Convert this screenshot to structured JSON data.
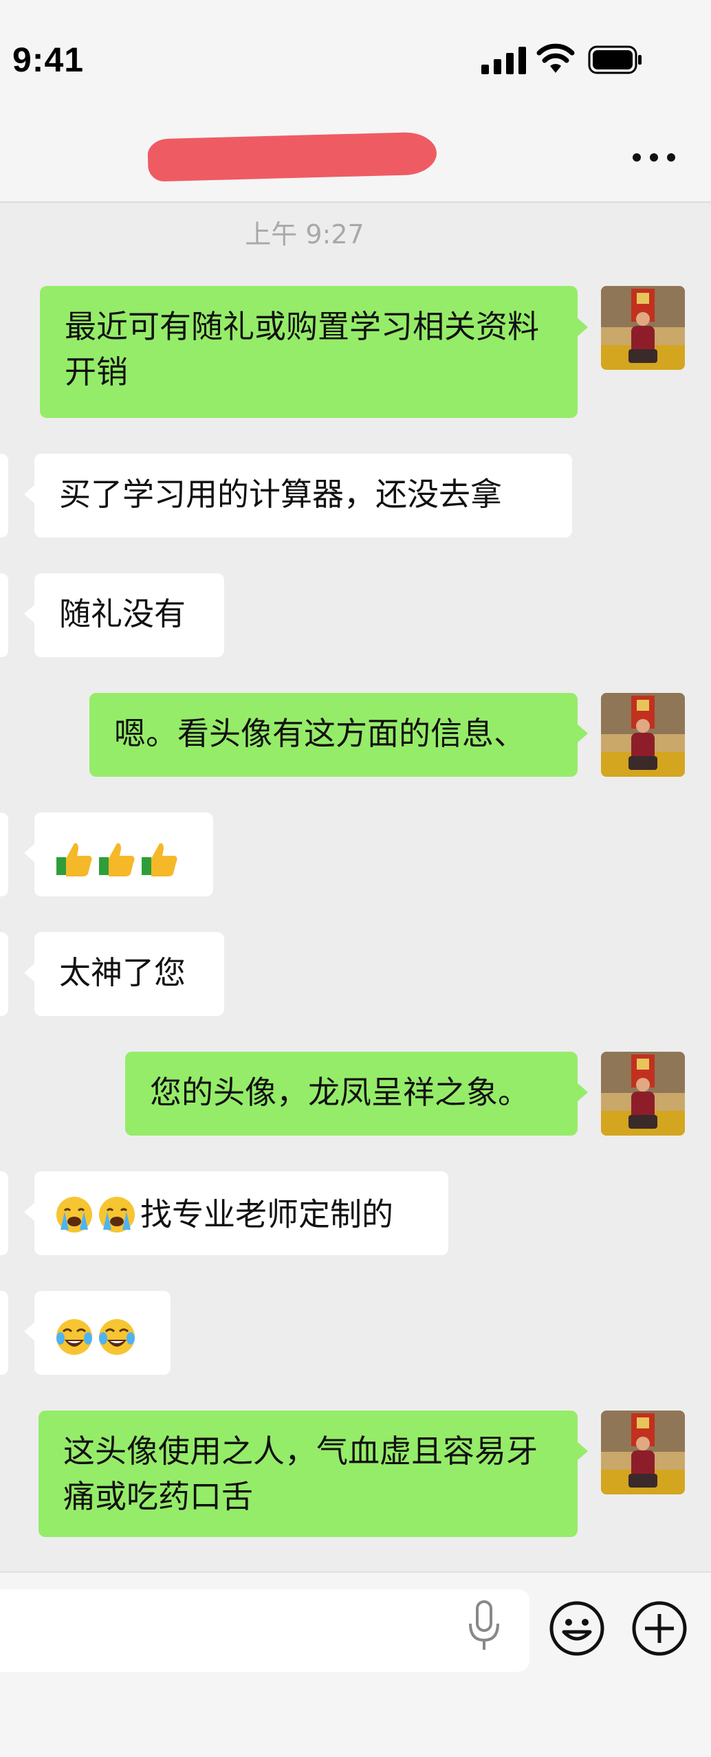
{
  "status": {
    "time": "9:41"
  },
  "nav": {
    "title_redacted": true,
    "more_icon": "more-dots-icon"
  },
  "chat": {
    "timestamp": "上午 9:27",
    "messages": [
      {
        "side": "me",
        "text": "最近可有随礼或购置学习相关资料开销"
      },
      {
        "side": "them",
        "text": "买了学习用的计算器，还没去拿"
      },
      {
        "side": "them",
        "text": "随礼没有"
      },
      {
        "side": "me",
        "text": "嗯。看头像有这方面的信息、"
      },
      {
        "side": "them",
        "emoji": [
          "thumbs-up",
          "thumbs-up",
          "thumbs-up"
        ],
        "text": ""
      },
      {
        "side": "them",
        "text": "太神了您"
      },
      {
        "side": "me",
        "text": "您的头像，龙凤呈祥之象。"
      },
      {
        "side": "them",
        "emoji": [
          "loudly-crying",
          "loudly-crying"
        ],
        "text": "找专业老师定制的"
      },
      {
        "side": "them",
        "emoji": [
          "tears-of-joy",
          "tears-of-joy"
        ],
        "text": ""
      },
      {
        "side": "me",
        "text": "这头像使用之人，气血虚且容易牙痛或吃药口舌"
      }
    ]
  },
  "input": {
    "value": "",
    "icons": [
      "mic-icon",
      "emoji-icon",
      "plus-icon"
    ]
  },
  "colors": {
    "me_bubble": "#95ec69",
    "them_bubble": "#ffffff",
    "background": "#ededed"
  }
}
